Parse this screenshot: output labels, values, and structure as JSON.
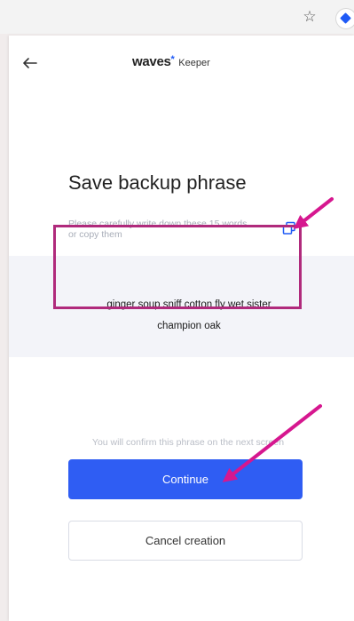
{
  "browser": {
    "icons": [
      "star-icon",
      "waves-keeper-extension-icon"
    ]
  },
  "header": {
    "back_icon": "arrow-left-icon",
    "logo_brand": "waves",
    "logo_mark": "*",
    "logo_product": "Keeper"
  },
  "main": {
    "title": "Save backup phrase",
    "subtitle": "Please carefully write down these 15 words or copy them",
    "copy_icon": "copy-icon",
    "phrase_line1": "ginger soup sniff cotton fly wet sister",
    "phrase_line2": "champion oak",
    "confirm_note": "You will confirm this phrase on the next screen",
    "continue_label": "Continue",
    "cancel_label": "Cancel creation"
  },
  "annotations": {
    "color": "#d6178f",
    "highlight_color": "#b02a7c"
  },
  "colors": {
    "primary": "#2f5df3",
    "brand_accent": "#1f5af6"
  }
}
